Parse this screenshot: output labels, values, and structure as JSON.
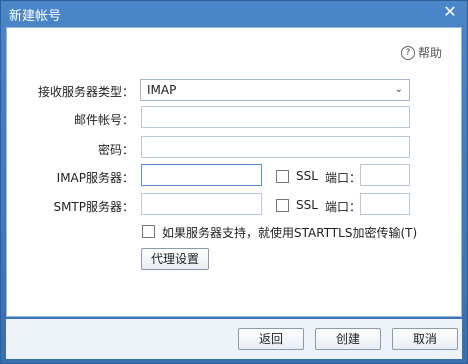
{
  "window": {
    "title": "新建帐号",
    "close_icon": "close-icon"
  },
  "help": {
    "label": "帮助",
    "icon": "question-circle-icon"
  },
  "form": {
    "server_type_label": "接收服务器类型：",
    "server_type_value": "IMAP",
    "account_label": "邮件帐号：",
    "account_value": "",
    "password_label": "密码：",
    "password_value": "",
    "imap_label": "IMAP服务器：",
    "imap_value": "",
    "imap_ssl_label": "SSL",
    "imap_port_label": "端口：",
    "imap_port_value": "",
    "smtp_label": "SMTP服务器：",
    "smtp_value": "",
    "smtp_ssl_label": "SSL",
    "smtp_port_label": "端口：",
    "smtp_port_value": "",
    "starttls_label": "如果服务器支持，就使用STARTTLS加密传输(T)",
    "proxy_button": "代理设置"
  },
  "footer": {
    "back_button": "返回",
    "create_button": "创建",
    "cancel_button": "取消"
  }
}
